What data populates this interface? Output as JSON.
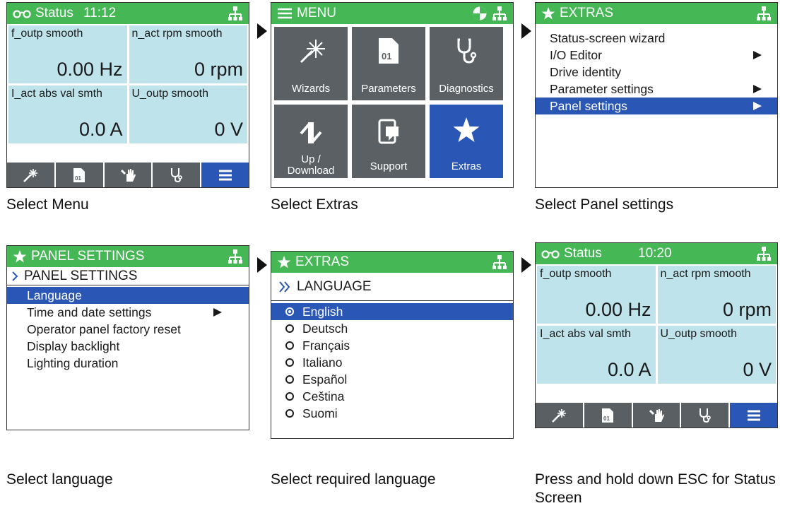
{
  "status": {
    "title": "Status",
    "time_a": "11:12",
    "time_b": "10:20",
    "cells": [
      {
        "label": "f_outp smooth",
        "value": "0.00 Hz"
      },
      {
        "label": "n_act rpm smooth",
        "value": "0 rpm"
      },
      {
        "label": "I_act abs val smth",
        "value": "0.0 A"
      },
      {
        "label": "U_outp smooth",
        "value": "0 V"
      }
    ],
    "tabs": [
      "wizard-icon",
      "parameters-icon",
      "hand-icon",
      "stethoscope-icon",
      "menu-icon"
    ]
  },
  "menu": {
    "title": "MENU",
    "tiles": [
      {
        "label": "Wizards",
        "icon": "wand-icon"
      },
      {
        "label": "Parameters",
        "icon": "document-icon"
      },
      {
        "label": "Diagnostics",
        "icon": "stethoscope-icon"
      },
      {
        "label": "Up / Download",
        "icon": "up-download-icon"
      },
      {
        "label": "Support",
        "icon": "tablet-icon"
      },
      {
        "label": "Extras",
        "icon": "star-icon"
      }
    ]
  },
  "extras": {
    "title": "EXTRAS",
    "items": [
      {
        "label": "Status-screen wizard",
        "submenu": false
      },
      {
        "label": "I/O Editor",
        "submenu": true
      },
      {
        "label": "Drive identity",
        "submenu": false
      },
      {
        "label": "Parameter settings",
        "submenu": true
      },
      {
        "label": "Panel settings",
        "submenu": true
      }
    ]
  },
  "panel": {
    "title": "PANEL SETTINGS",
    "subtitle": "PANEL SETTINGS",
    "items": [
      {
        "label": "Language",
        "submenu": false
      },
      {
        "label": "Time and date settings",
        "submenu": true
      },
      {
        "label": "Operator panel factory reset",
        "submenu": false
      },
      {
        "label": "Display backlight",
        "submenu": false
      },
      {
        "label": "Lighting duration",
        "submenu": false
      }
    ]
  },
  "language": {
    "title": "EXTRAS",
    "subtitle": "LANGUAGE",
    "options": [
      "English",
      "Deutsch",
      "Français",
      "Italiano",
      "Español",
      "Ceština",
      "Suomi"
    ]
  },
  "captions": [
    "Select Menu",
    "Select Extras",
    "Select Panel settings",
    "Select language",
    "Select required language",
    "Press and hold down ESC for Status Screen"
  ],
  "colors": {
    "titlebar": "#45b855",
    "selection": "#2a56b5",
    "cell": "#bfe3ea",
    "tile": "#5b6064"
  }
}
